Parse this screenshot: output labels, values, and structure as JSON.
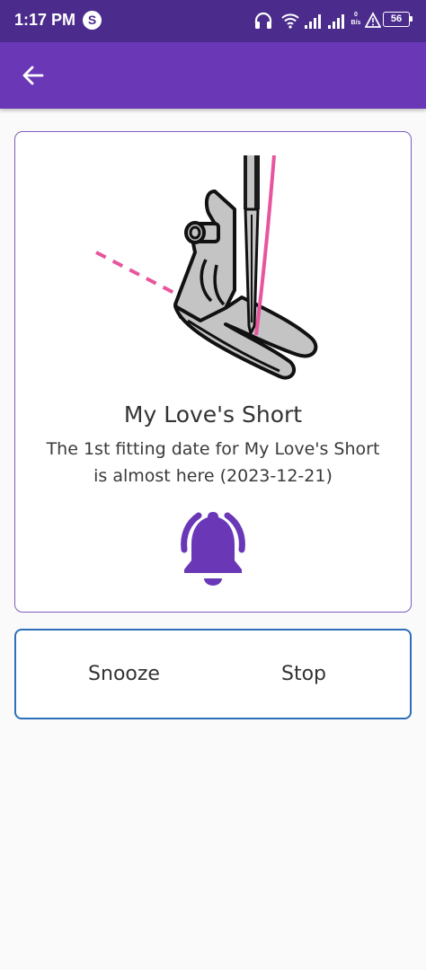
{
  "status_bar": {
    "time": "1:17 PM",
    "app_icon_letter": "S",
    "speed_top": "0",
    "speed_unit": "B/s",
    "battery_level": "56",
    "icons": [
      "headset-icon",
      "wifi-icon",
      "signal-icon",
      "signal-icon",
      "alert-icon",
      "battery-icon"
    ]
  },
  "app_bar": {
    "back_icon": "arrow-left-icon"
  },
  "reminder": {
    "title": "My Love's Short",
    "message": "The 1st fitting date for My Love's Short is almost here (2023-12-21)",
    "illustration": "sewing-machine-presser-foot",
    "bell_icon": "ringing-bell-icon"
  },
  "actions": {
    "snooze_label": "Snooze",
    "stop_label": "Stop"
  },
  "colors": {
    "status_bar": "#4b2c8c",
    "app_bar": "#6a38b7",
    "accent": "#6a38b7",
    "thread_pink": "#e8559e",
    "actions_border": "#2d6fb8"
  }
}
